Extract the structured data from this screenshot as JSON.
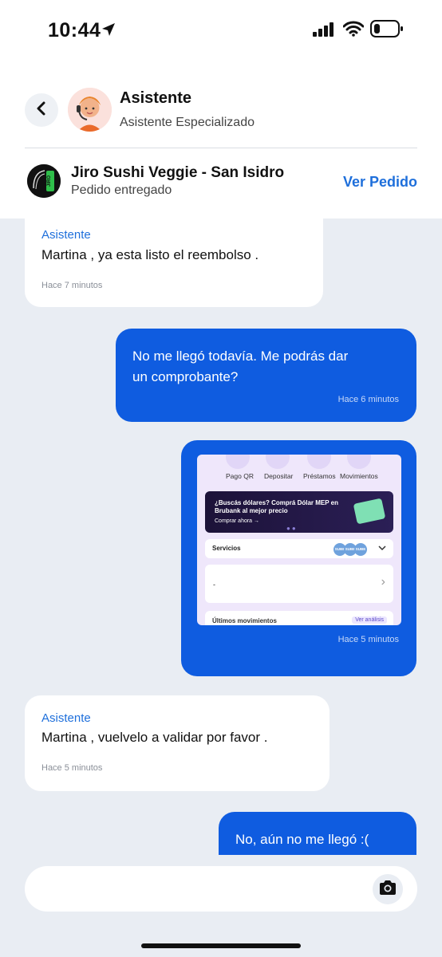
{
  "status_bar": {
    "time": "10:44"
  },
  "header": {
    "back_icon": "chevron-left-icon",
    "assistant_name": "Asistente",
    "assistant_role": "Asistente Especializado",
    "store_name": "Jiro Sushi Veggie - San Isidro",
    "order_status": "Pedido entregado",
    "view_order_label": "Ver Pedido",
    "store_logo_text": "JIRO"
  },
  "messages": [
    {
      "direction": "in",
      "sender": "Asistente",
      "text": "Martina , ya esta listo el reembolso .",
      "time": "Hace 7 minutos"
    },
    {
      "direction": "out",
      "lines": [
        "No me llegó todavía. Me podrás dar",
        "un comprobante?"
      ],
      "time": "Hace 6 minutos"
    },
    {
      "direction": "out",
      "type": "image",
      "time": "Hace 5 minutos",
      "screenshot": {
        "menu": [
          "Pago QR",
          "Depositar",
          "Préstamos",
          "Movimientos"
        ],
        "promo_title": "¿Buscás dólares? Comprá Dólar MEP en Brubank al mejor precio",
        "promo_link": "Comprar ahora →",
        "services_label": "Servicios",
        "sube_badges": [
          "SUBE",
          "SUBE",
          "SUBE"
        ],
        "card_text": "-",
        "movements_label": "Últimos movimientos",
        "movements_link": "Ver análisis"
      }
    },
    {
      "direction": "in",
      "sender": "Asistente",
      "text": "Martina , vuelvelo a validar por favor .",
      "time": "Hace 5 minutos"
    },
    {
      "direction": "out",
      "text": "No, aún no me llegó :("
    }
  ],
  "composer": {
    "value": "",
    "camera_icon": "camera-icon"
  },
  "colors": {
    "accent": "#1e6fdb",
    "outgoing_bubble": "#0f5ce0",
    "background": "#e9edf3"
  }
}
